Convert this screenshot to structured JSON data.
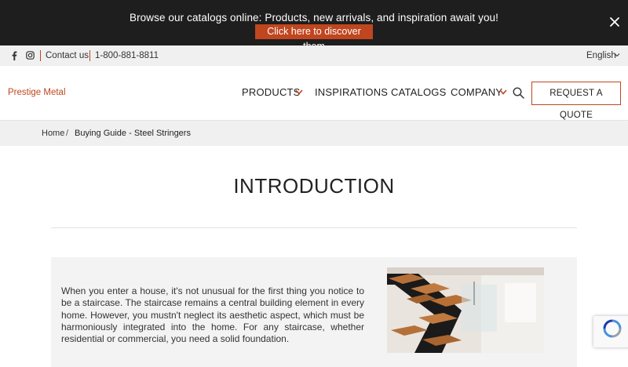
{
  "promo": {
    "text": "Browse our catalogs online: Products, new arrivals, and inspiration await you!",
    "button_label": "Click here to discover them",
    "close_icon": "close-icon"
  },
  "utility": {
    "social_icons": [
      "facebook-icon",
      "instagram-icon"
    ],
    "contact_label": "Contact us",
    "phone": "1-800-881-8811",
    "language": "English"
  },
  "header": {
    "logo_text": "Prestige Metal",
    "nav": {
      "products": "PRODUCTS",
      "inspirations": "INSPIRATIONS",
      "catalogs": "CATALOGS",
      "company": "COMPANY"
    },
    "quote_button": "REQUEST A QUOTE"
  },
  "breadcrumb": {
    "home": "Home",
    "separator": "/",
    "current": "Buying Guide - Steel Stringers"
  },
  "main": {
    "title": "INTRODUCTION",
    "paragraph": "When you enter a house, it's not unusual for the first thing you notice to be a staircase. The staircase remains a central building element in every home. However, you mustn't neglect its aesthetic aspect, which must be harmoniously integrated into the home. For any staircase, whether residential or commercial, you need a solid foundation."
  },
  "colors": {
    "accent": "#c0461f",
    "banner_bg": "#1e1e1e",
    "bar_bg": "#f0f0f0"
  }
}
